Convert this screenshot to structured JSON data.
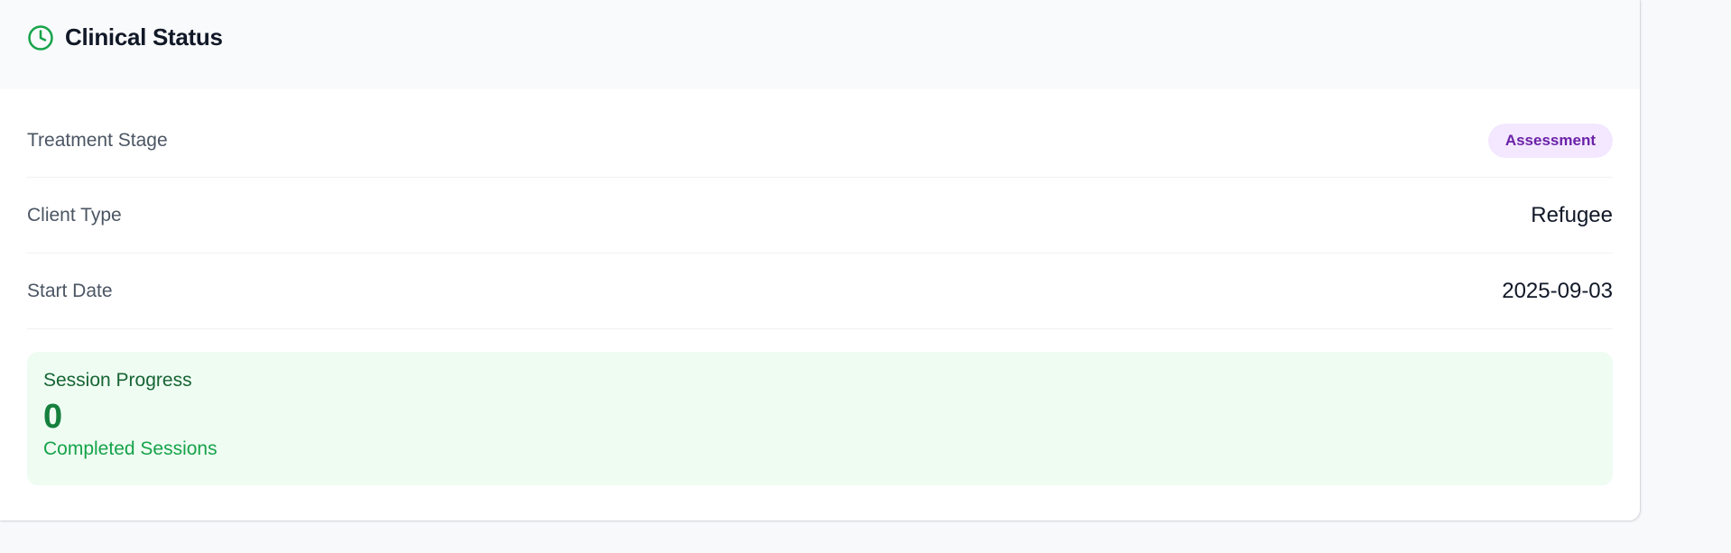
{
  "header": {
    "title": "Clinical Status",
    "icon": "clock-icon",
    "icon_color": "#16a34a"
  },
  "fields": {
    "treatment_stage": {
      "label": "Treatment Stage",
      "value": "Assessment",
      "badge_bg": "#f3e8ff",
      "badge_color": "#6b21a8"
    },
    "client_type": {
      "label": "Client Type",
      "value": "Refugee"
    },
    "start_date": {
      "label": "Start Date",
      "value": "2025-09-03"
    }
  },
  "session_progress": {
    "title": "Session Progress",
    "count": "0",
    "caption": "Completed Sessions",
    "bg_color": "#effcf2",
    "accent": "#15803d"
  }
}
